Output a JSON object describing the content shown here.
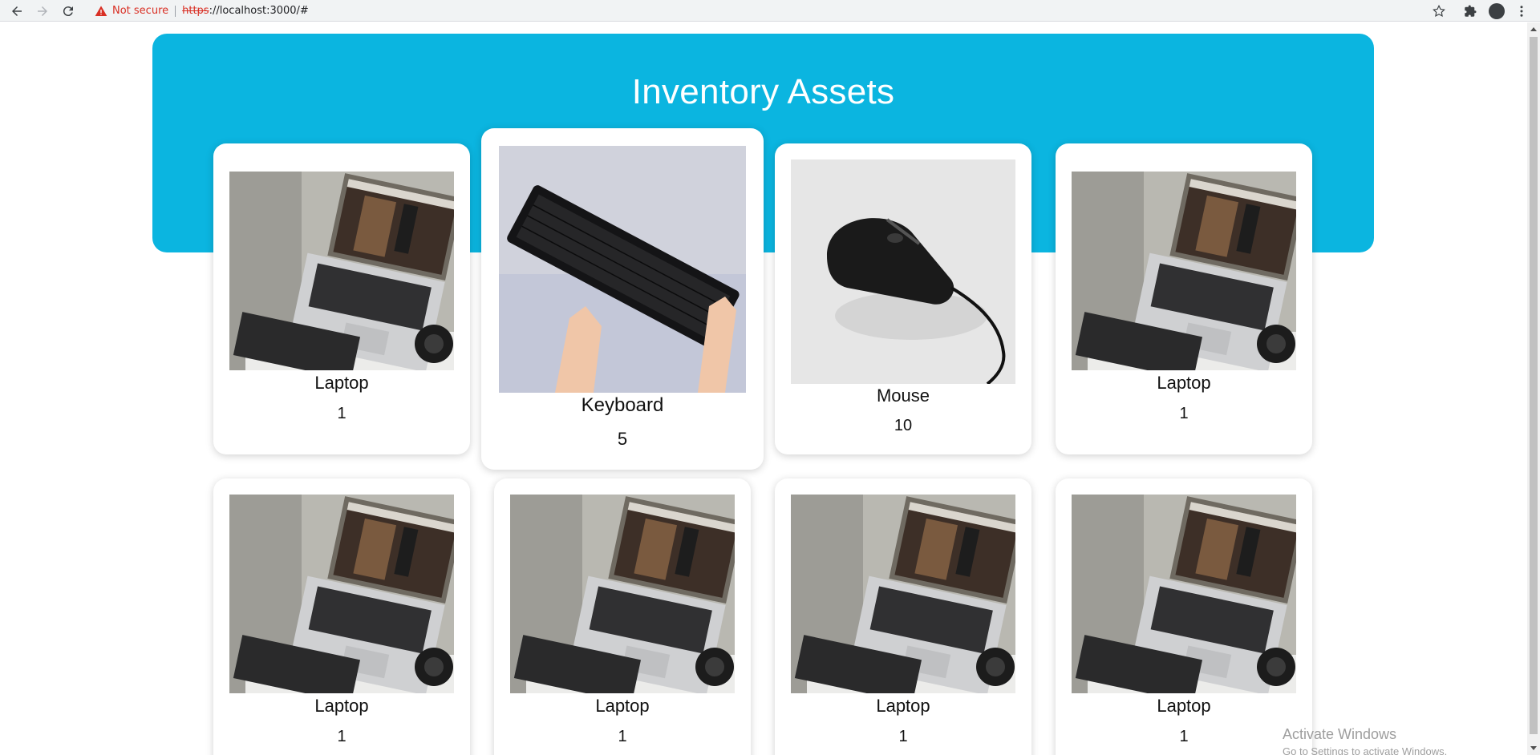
{
  "browser": {
    "security_label": "Not secure",
    "url_scheme": "https",
    "url_rest": "://localhost:3000/#"
  },
  "page": {
    "title": "Inventory Assets",
    "accent_color": "#0bb5e0"
  },
  "cards": [
    {
      "name": "Laptop",
      "qty": "1",
      "image": "laptop-image"
    },
    {
      "name": "Keyboard",
      "qty": "5",
      "image": "keyboard-image"
    },
    {
      "name": "Mouse",
      "qty": "10",
      "image": "mouse-image"
    },
    {
      "name": "Laptop",
      "qty": "1",
      "image": "laptop-image"
    },
    {
      "name": "Laptop",
      "qty": "1",
      "image": "laptop-image"
    },
    {
      "name": "Laptop",
      "qty": "1",
      "image": "laptop-image"
    },
    {
      "name": "Laptop",
      "qty": "1",
      "image": "laptop-image"
    },
    {
      "name": "Laptop",
      "qty": "1",
      "image": "laptop-image"
    }
  ],
  "os_watermark": {
    "line1": "Activate Windows",
    "line2": "Go to Settings to activate Windows."
  }
}
